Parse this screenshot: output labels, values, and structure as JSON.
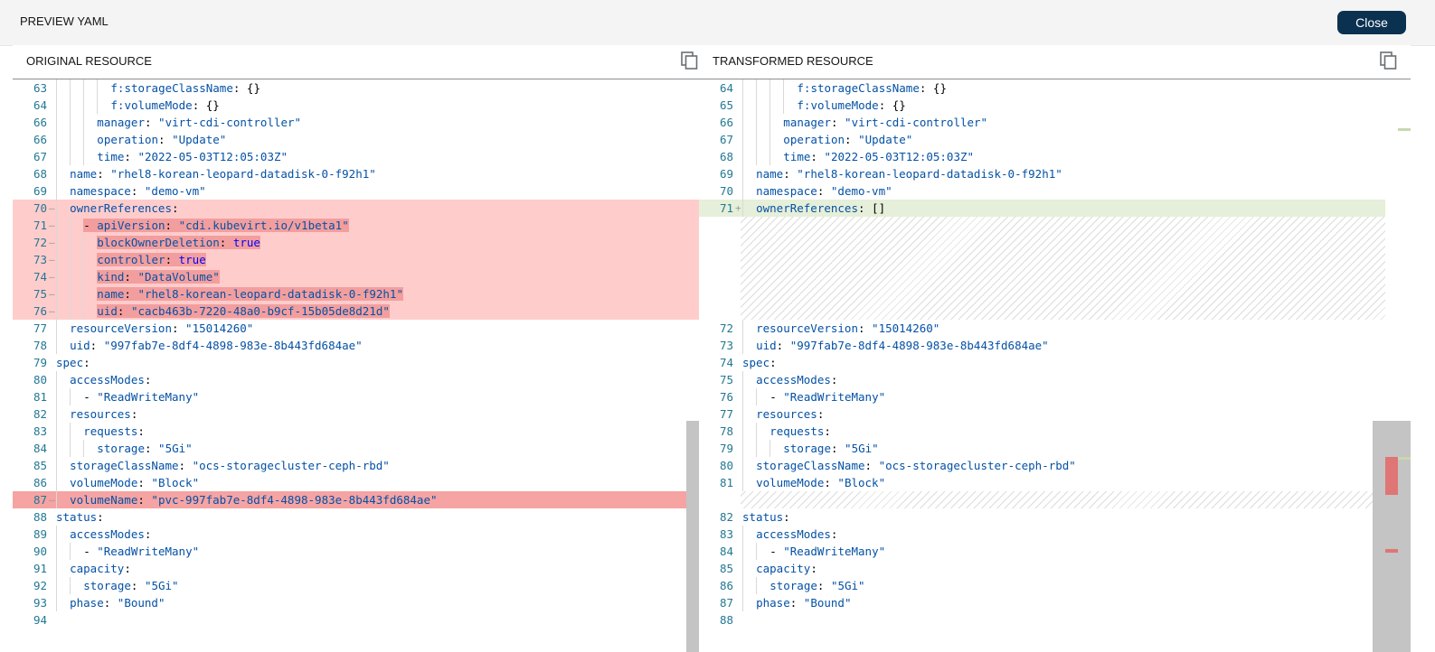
{
  "header": {
    "title": "PREVIEW YAML",
    "close_label": "Close"
  },
  "colors": {
    "removed_line": "#ffcccc",
    "removed_emphasis": "#f5a3a3",
    "added_line": "#e6efd9",
    "close_button": "#0b3150"
  },
  "original": {
    "title": "ORIGINAL RESOURCE",
    "lines": [
      {
        "n": "63",
        "indent": 8,
        "key": "f:storageClassName",
        "val": "{}",
        "vt": "p"
      },
      {
        "n": "64",
        "indent": 8,
        "key": "f:volumeMode",
        "val": "{}",
        "vt": "p"
      },
      {
        "n": "66",
        "indent": 6,
        "key": "manager",
        "val": "\"virt-cdi-controller\"",
        "vt": "s"
      },
      {
        "n": "66",
        "indent": 6,
        "key": "operation",
        "val": "\"Update\"",
        "vt": "s"
      },
      {
        "n": "67",
        "indent": 6,
        "key": "time",
        "val": "\"2022-05-03T12:05:03Z\"",
        "vt": "s"
      },
      {
        "n": "68",
        "indent": 2,
        "key": "name",
        "val": "\"rhel8-korean-leopard-datadisk-0-f92h1\"",
        "vt": "s"
      },
      {
        "n": "69",
        "indent": 2,
        "key": "namespace",
        "val": "\"demo-vm\"",
        "vt": "s"
      },
      {
        "n": "70",
        "indent": 2,
        "key": "ownerReferences",
        "val": "",
        "vt": "p",
        "diff": "removed",
        "marker": "—"
      },
      {
        "n": "71",
        "indent": 4,
        "dash": true,
        "key": "apiVersion",
        "val": "\"cdi.kubevirt.io/v1beta1\"",
        "vt": "s",
        "diff": "removed",
        "marker": "—",
        "emph": true
      },
      {
        "n": "72",
        "indent": 6,
        "key": "blockOwnerDeletion",
        "val": "true",
        "vt": "b",
        "diff": "removed",
        "marker": "—",
        "emph": true
      },
      {
        "n": "73",
        "indent": 6,
        "key": "controller",
        "val": "true",
        "vt": "b",
        "diff": "removed",
        "marker": "—",
        "emph": true
      },
      {
        "n": "74",
        "indent": 6,
        "key": "kind",
        "val": "\"DataVolume\"",
        "vt": "s",
        "diff": "removed",
        "marker": "—",
        "emph": true
      },
      {
        "n": "75",
        "indent": 6,
        "key": "name",
        "val": "\"rhel8-korean-leopard-datadisk-0-f92h1\"",
        "vt": "s",
        "diff": "removed",
        "marker": "—",
        "emph": true
      },
      {
        "n": "76",
        "indent": 6,
        "key": "uid",
        "val": "\"cacb463b-7220-48a0-b9cf-15b05de8d21d\"",
        "vt": "s",
        "diff": "removed",
        "marker": "—",
        "emph": true
      },
      {
        "n": "77",
        "indent": 2,
        "key": "resourceVersion",
        "val": "\"15014260\"",
        "vt": "s"
      },
      {
        "n": "78",
        "indent": 2,
        "key": "uid",
        "val": "\"997fab7e-8df4-4898-983e-8b443fd684ae\"",
        "vt": "s"
      },
      {
        "n": "79",
        "indent": 0,
        "key": "spec",
        "val": "",
        "vt": "p"
      },
      {
        "n": "80",
        "indent": 2,
        "key": "accessModes",
        "val": "",
        "vt": "p"
      },
      {
        "n": "81",
        "indent": 4,
        "dash": true,
        "key": "",
        "val": "\"ReadWriteMany\"",
        "vt": "s"
      },
      {
        "n": "82",
        "indent": 2,
        "key": "resources",
        "val": "",
        "vt": "p"
      },
      {
        "n": "83",
        "indent": 4,
        "key": "requests",
        "val": "",
        "vt": "p"
      },
      {
        "n": "84",
        "indent": 6,
        "key": "storage",
        "val": "\"5Gi\"",
        "vt": "s"
      },
      {
        "n": "85",
        "indent": 2,
        "key": "storageClassName",
        "val": "\"ocs-storagecluster-ceph-rbd\"",
        "vt": "s"
      },
      {
        "n": "86",
        "indent": 2,
        "key": "volumeMode",
        "val": "\"Block\"",
        "vt": "s"
      },
      {
        "n": "87",
        "indent": 2,
        "key": "volumeName",
        "val": "\"pvc-997fab7e-8df4-4898-983e-8b443fd684ae\"",
        "vt": "s",
        "diff": "removed",
        "marker": "—",
        "strong": true
      },
      {
        "n": "88",
        "indent": 0,
        "key": "status",
        "val": "",
        "vt": "p"
      },
      {
        "n": "89",
        "indent": 2,
        "key": "accessModes",
        "val": "",
        "vt": "p"
      },
      {
        "n": "90",
        "indent": 4,
        "dash": true,
        "key": "",
        "val": "\"ReadWriteMany\"",
        "vt": "s"
      },
      {
        "n": "91",
        "indent": 2,
        "key": "capacity",
        "val": "",
        "vt": "p"
      },
      {
        "n": "92",
        "indent": 4,
        "key": "storage",
        "val": "\"5Gi\"",
        "vt": "s"
      },
      {
        "n": "93",
        "indent": 2,
        "key": "phase",
        "val": "\"Bound\"",
        "vt": "s"
      },
      {
        "n": "94",
        "indent": 0,
        "key": "",
        "val": "",
        "vt": "p"
      }
    ]
  },
  "transformed": {
    "title": "TRANSFORMED RESOURCE",
    "lines": [
      {
        "n": "64",
        "indent": 8,
        "key": "f:storageClassName",
        "val": "{}",
        "vt": "p"
      },
      {
        "n": "65",
        "indent": 8,
        "key": "f:volumeMode",
        "val": "{}",
        "vt": "p"
      },
      {
        "n": "66",
        "indent": 6,
        "key": "manager",
        "val": "\"virt-cdi-controller\"",
        "vt": "s"
      },
      {
        "n": "67",
        "indent": 6,
        "key": "operation",
        "val": "\"Update\"",
        "vt": "s"
      },
      {
        "n": "68",
        "indent": 6,
        "key": "time",
        "val": "\"2022-05-03T12:05:03Z\"",
        "vt": "s"
      },
      {
        "n": "69",
        "indent": 2,
        "key": "name",
        "val": "\"rhel8-korean-leopard-datadisk-0-f92h1\"",
        "vt": "s"
      },
      {
        "n": "70",
        "indent": 2,
        "key": "namespace",
        "val": "\"demo-vm\"",
        "vt": "s"
      },
      {
        "n": "71",
        "indent": 2,
        "key": "ownerReferences",
        "val": "[]",
        "vt": "p",
        "diff": "added",
        "marker": "+"
      },
      {
        "filler": 6
      },
      {
        "n": "72",
        "indent": 2,
        "key": "resourceVersion",
        "val": "\"15014260\"",
        "vt": "s"
      },
      {
        "n": "73",
        "indent": 2,
        "key": "uid",
        "val": "\"997fab7e-8df4-4898-983e-8b443fd684ae\"",
        "vt": "s"
      },
      {
        "n": "74",
        "indent": 0,
        "key": "spec",
        "val": "",
        "vt": "p"
      },
      {
        "n": "75",
        "indent": 2,
        "key": "accessModes",
        "val": "",
        "vt": "p"
      },
      {
        "n": "76",
        "indent": 4,
        "dash": true,
        "key": "",
        "val": "\"ReadWriteMany\"",
        "vt": "s"
      },
      {
        "n": "77",
        "indent": 2,
        "key": "resources",
        "val": "",
        "vt": "p"
      },
      {
        "n": "78",
        "indent": 4,
        "key": "requests",
        "val": "",
        "vt": "p"
      },
      {
        "n": "79",
        "indent": 6,
        "key": "storage",
        "val": "\"5Gi\"",
        "vt": "s"
      },
      {
        "n": "80",
        "indent": 2,
        "key": "storageClassName",
        "val": "\"ocs-storagecluster-ceph-rbd\"",
        "vt": "s"
      },
      {
        "n": "81",
        "indent": 2,
        "key": "volumeMode",
        "val": "\"Block\"",
        "vt": "s"
      },
      {
        "filler": 1
      },
      {
        "n": "82",
        "indent": 0,
        "key": "status",
        "val": "",
        "vt": "p"
      },
      {
        "n": "83",
        "indent": 2,
        "key": "accessModes",
        "val": "",
        "vt": "p"
      },
      {
        "n": "84",
        "indent": 4,
        "dash": true,
        "key": "",
        "val": "\"ReadWriteMany\"",
        "vt": "s"
      },
      {
        "n": "85",
        "indent": 2,
        "key": "capacity",
        "val": "",
        "vt": "p"
      },
      {
        "n": "86",
        "indent": 4,
        "key": "storage",
        "val": "\"5Gi\"",
        "vt": "s"
      },
      {
        "n": "87",
        "indent": 2,
        "key": "phase",
        "val": "\"Bound\"",
        "vt": "s"
      },
      {
        "n": "88",
        "indent": 0,
        "key": "",
        "val": "",
        "vt": "p"
      }
    ]
  }
}
